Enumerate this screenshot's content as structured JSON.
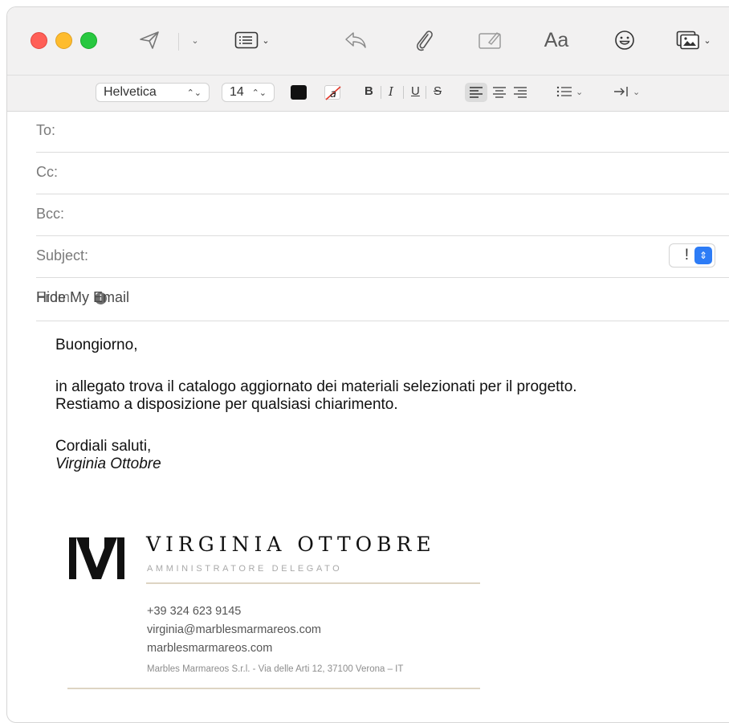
{
  "toolbar": {
    "font_family": "Helvetica",
    "font_size": "14",
    "aa_label": "Aa",
    "bold": "B",
    "italic": "I",
    "underline": "U",
    "strike": "S",
    "icons": [
      "send-icon",
      "header-fields-icon",
      "reply-icon",
      "attachment-icon",
      "markup-icon",
      "format-icon",
      "emoji-icon",
      "photo-browser-icon"
    ]
  },
  "colors": {
    "text_color": "#111111",
    "accent": "#2d7cf6",
    "rule": "#ddd4c3"
  },
  "fields": {
    "to_label": "To:",
    "cc_label": "Cc:",
    "bcc_label": "Bcc:",
    "subject_label": "Subject:",
    "from_label": "From:",
    "from_value": "Hide My Email",
    "priority_symbol": "!"
  },
  "message": {
    "greeting": "Buongiorno,",
    "line1": "in allegato trova il catalogo aggiornato dei materiali selezionati per il progetto.",
    "line2": "Restiamo a disposizione per qualsiasi chiarimento.",
    "closing": "Cordiali saluti,",
    "signoff": "Virginia Ottobre"
  },
  "signature": {
    "name": "VIRGINIA OTTOBRE",
    "role": "AMMINISTRATORE DELEGATO",
    "phone": "+39 324 623 9145",
    "email": "virginia@marblesmarmareos.com",
    "website": "marblesmarmareos.com",
    "address": "Marbles Marmareos S.r.l. - Via delle Arti 12, 37100 Verona – IT"
  }
}
